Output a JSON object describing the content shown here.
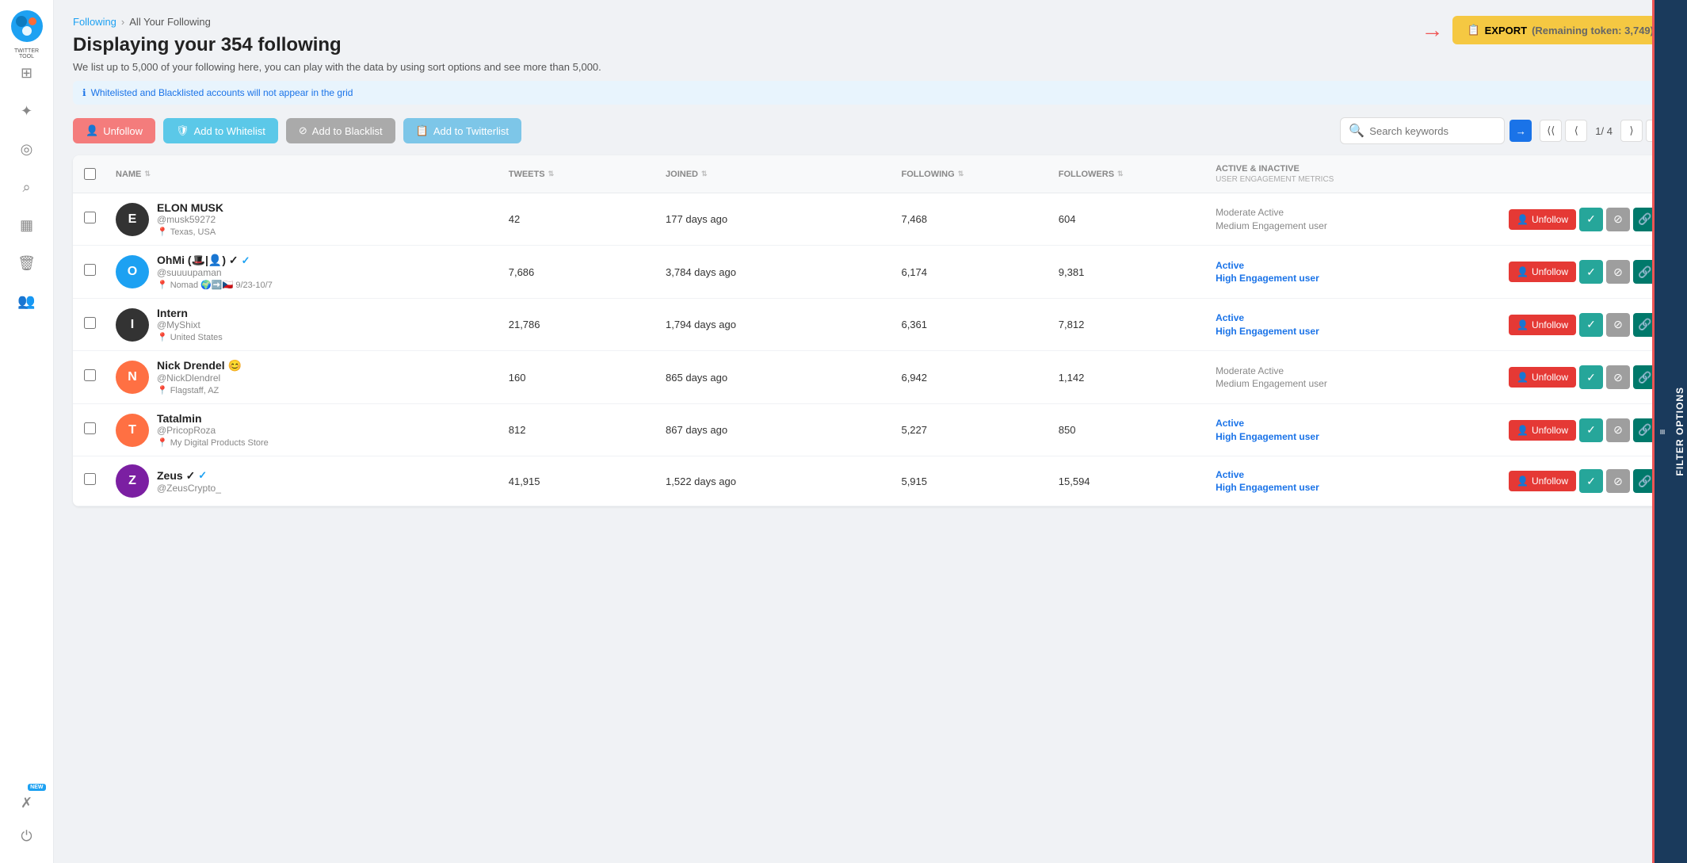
{
  "app": {
    "name": "TWITTER TOOL"
  },
  "sidebar": {
    "items": [
      {
        "name": "dashboard-icon",
        "icon": "⊞",
        "active": false
      },
      {
        "name": "network-icon",
        "icon": "✦",
        "active": false
      },
      {
        "name": "target-icon",
        "icon": "◎",
        "active": false
      },
      {
        "name": "search-icon",
        "icon": "⌕",
        "active": false
      },
      {
        "name": "chart-icon",
        "icon": "▦",
        "active": false
      },
      {
        "name": "trash-icon",
        "icon": "🗑",
        "active": false
      },
      {
        "name": "users-icon",
        "icon": "👥",
        "active": false
      }
    ],
    "bottom_items": [
      {
        "name": "x-icon",
        "icon": "✗",
        "badge": "NEW"
      },
      {
        "name": "power-icon",
        "icon": "⏻"
      }
    ]
  },
  "breadcrumb": {
    "parent": "Following",
    "separator": "›",
    "current": "All Your Following"
  },
  "page": {
    "title": "Displaying your 354 following",
    "subtitle": "We list up to 5,000 of your following here, you can play with the data by using sort options and see more than 5,000.",
    "info_message": "Whitelisted and Blacklisted accounts will not appear in the grid"
  },
  "export": {
    "label": "EXPORT",
    "remaining_label": "(Remaining token:",
    "remaining_value": "3,749)"
  },
  "toolbar": {
    "unfollow_label": "Unfollow",
    "whitelist_label": "Add to Whitelist",
    "blacklist_label": "Add to Blacklist",
    "twitterlist_label": "Add to Twitterlist",
    "search_placeholder": "Search keywords"
  },
  "pagination": {
    "current": "1",
    "total": "4"
  },
  "table": {
    "columns": [
      {
        "key": "check",
        "label": ""
      },
      {
        "key": "name",
        "label": "NAME"
      },
      {
        "key": "tweets",
        "label": "TWEETS"
      },
      {
        "key": "joined",
        "label": "JOINED"
      },
      {
        "key": "following",
        "label": "FOLLOWING"
      },
      {
        "key": "followers",
        "label": "FOLLOWERS"
      },
      {
        "key": "engagement",
        "label": "ACTIVE & INACTIVE",
        "sub": "User Engagement Metrics"
      },
      {
        "key": "actions",
        "label": ""
      }
    ],
    "rows": [
      {
        "id": 1,
        "name": "ELON MUSK",
        "handle": "@musk59272",
        "location": "Texas, USA",
        "avatar_text": "E",
        "avatar_class": "dark",
        "tweets": "42",
        "joined": "177 days ago",
        "following": "7,468",
        "followers": "604",
        "engagement_line1": "Moderate Active",
        "engagement_line2": "Medium Engagement",
        "engagement_line3": "user",
        "engagement_class": "mod-active",
        "verified": false
      },
      {
        "id": 2,
        "name": "OhMi (🎩|👤) ✓",
        "handle": "@suuuupaman",
        "location": "Nomad 🌍➡️🇨🇿 9/23-10/7",
        "avatar_text": "O",
        "avatar_class": "blue",
        "tweets": "7,686",
        "joined": "3,784 days ago",
        "following": "6,174",
        "followers": "9,381",
        "engagement_line1": "Active",
        "engagement_line2": "High Engagement user",
        "engagement_line3": "",
        "engagement_class": "active-high",
        "verified": true
      },
      {
        "id": 3,
        "name": "Intern",
        "handle": "@MyShixt",
        "location": "United States",
        "avatar_text": "I",
        "avatar_class": "dark",
        "tweets": "21,786",
        "joined": "1,794 days ago",
        "following": "6,361",
        "followers": "7,812",
        "engagement_line1": "Active",
        "engagement_line2": "High Engagement user",
        "engagement_line3": "",
        "engagement_class": "active-high",
        "verified": false
      },
      {
        "id": 4,
        "name": "Nick Drendel 😊",
        "handle": "@NickDlendrel",
        "location": "Flagstaff, AZ",
        "avatar_text": "N",
        "avatar_class": "orange",
        "tweets": "160",
        "joined": "865 days ago",
        "following": "6,942",
        "followers": "1,142",
        "engagement_line1": "Moderate Active",
        "engagement_line2": "Medium Engagement",
        "engagement_line3": "user",
        "engagement_class": "mod-active",
        "verified": false
      },
      {
        "id": 5,
        "name": "Tatalmin",
        "handle": "@PricopRoza",
        "location": "My Digital Products Store",
        "avatar_text": "T",
        "avatar_class": "orange",
        "tweets": "812",
        "joined": "867 days ago",
        "following": "5,227",
        "followers": "850",
        "engagement_line1": "Active",
        "engagement_line2": "High Engagement user",
        "engagement_line3": "",
        "engagement_class": "active-high",
        "verified": false
      },
      {
        "id": 6,
        "name": "Zeus ✓",
        "handle": "@ZeusCrypto_",
        "location": "",
        "avatar_text": "Z",
        "avatar_class": "purple",
        "tweets": "41,915",
        "joined": "1,522 days ago",
        "following": "5,915",
        "followers": "15,594",
        "engagement_line1": "Active",
        "engagement_line2": "High Engagement user",
        "engagement_line3": "",
        "engagement_class": "active-high",
        "verified": true
      }
    ]
  },
  "filter_panel": {
    "label": "FILTER OPTIONS"
  },
  "actions": {
    "unfollow": "Unfollow",
    "whitelist_icon": "✓",
    "blacklist_icon": "⊘",
    "link_icon": "🔗"
  }
}
